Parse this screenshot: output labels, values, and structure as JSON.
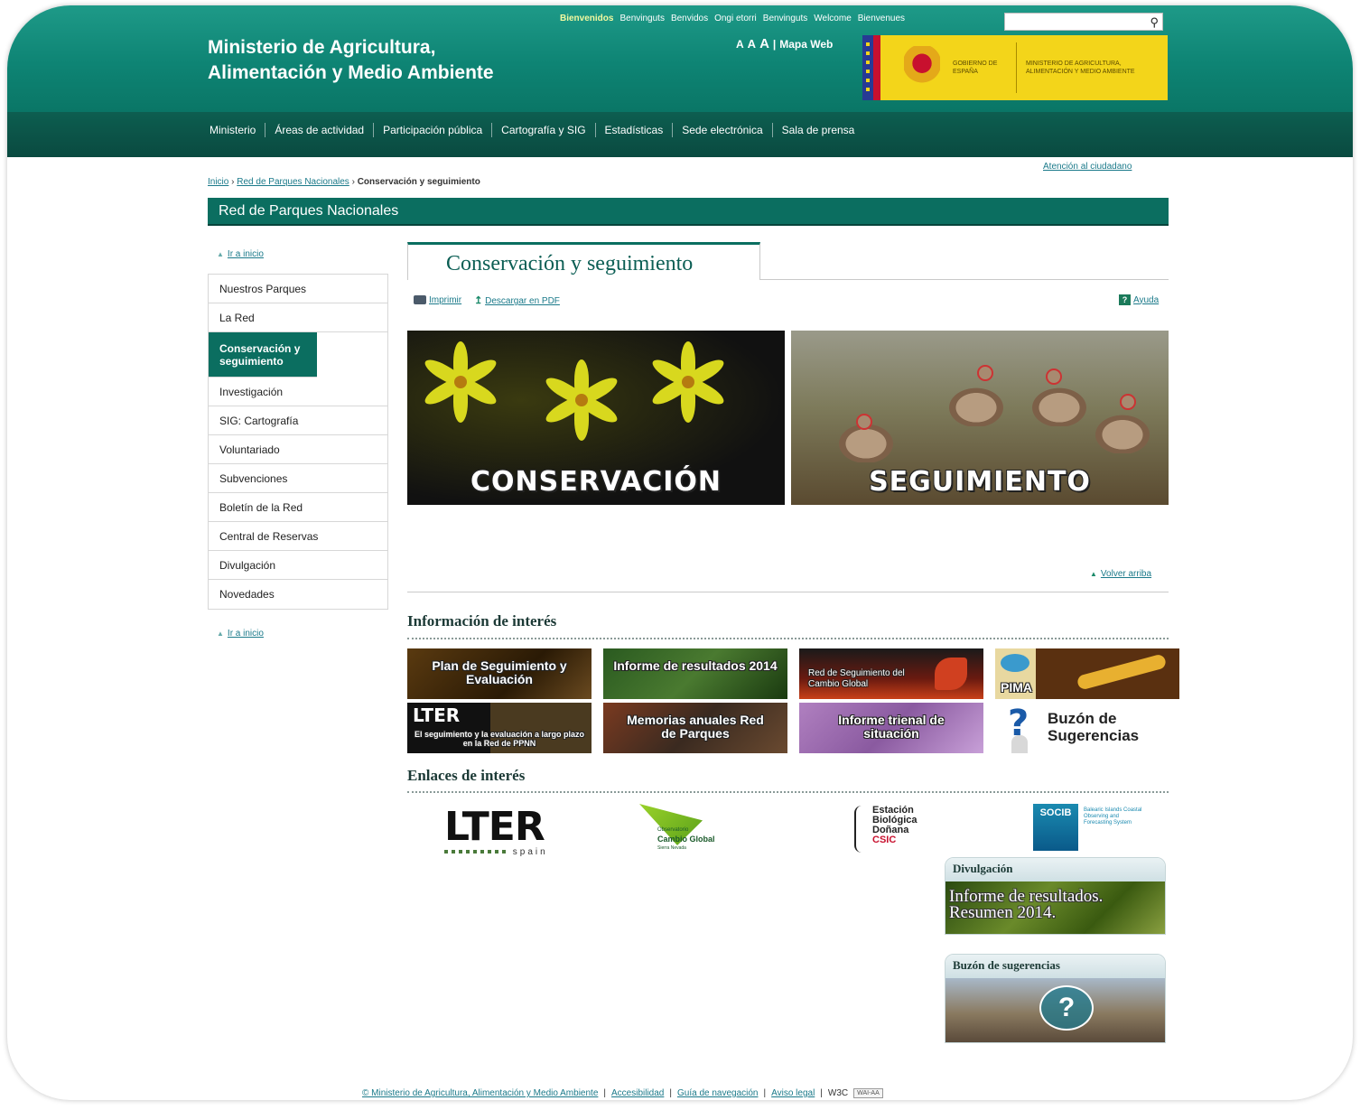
{
  "header": {
    "title_line1": "Ministerio de Agricultura,",
    "title_line2": "Alimentación y Medio Ambiente",
    "languages": [
      "Bienvenidos",
      "Benvinguts",
      "Benvidos",
      "Ongi etorri",
      "Benvinguts",
      "Welcome",
      "Bienvenues"
    ],
    "font_size_labels": [
      "A",
      "A",
      "A"
    ],
    "map_link": "Mapa Web",
    "gov_label": "GOBIERNO DE ESPAÑA",
    "ministry_label": "MINISTERIO DE AGRICULTURA, ALIMENTACIÓN Y MEDIO AMBIENTE",
    "search_icon": "search-icon"
  },
  "nav": [
    "Ministerio",
    "Áreas de actividad",
    "Participación pública",
    "Cartografía y SIG",
    "Estadísticas",
    "Sede electrónica",
    "Sala de prensa"
  ],
  "breadcrumb": {
    "home": "Inicio",
    "parent": "Red de Parques Nacionales",
    "current": "Conservación y seguimiento",
    "separator": "›"
  },
  "attention_link": "Atención al ciudadano",
  "section_title": "Red de Parques Nacionales",
  "goto_top_label": "Ir a inicio",
  "sidenav": [
    "Nuestros Parques",
    "La Red",
    "Conservación y seguimiento",
    "Investigación",
    "SIG: Cartografía",
    "Voluntariado",
    "Subvenciones",
    "Boletín de la Red",
    "Central de Reservas",
    "Divulgación",
    "Novedades"
  ],
  "main": {
    "tab_title": "Conservación y seguimiento",
    "print_label": "Imprimir",
    "pdf_label": "Descargar en PDF",
    "help_label": "Ayuda",
    "banner_left": "CONSERVACIÓN",
    "banner_right": "SEGUIMIENTO",
    "back_top": "Volver arriba"
  },
  "info_section": {
    "title": "Información de interés",
    "tiles": [
      "Plan de Seguimiento y Evaluación",
      "Informe de resultados 2014",
      "Red de Seguimiento del Cambio Global",
      "PIMA",
      "El seguimiento y la evaluación a largo plazo en la Red de PPNN",
      "Memorias anuales Red de Parques",
      "Informe trienal de situación",
      "Buzón de Sugerencias"
    ],
    "lter_label": "LTER"
  },
  "links_section": {
    "title": "Enlaces de interés",
    "lter": "LTER",
    "lter_sub": "spain",
    "ocg_small": "Observatorio",
    "ocg": "Cambio Global",
    "ocg_sub": "Sierra Nevada",
    "ebd": [
      "Estación",
      "Biológica",
      "Doñana",
      "CSIC"
    ],
    "socib": "SOCIB",
    "socib_text": "Balearic Islands Coastal Observing and Forecasting System"
  },
  "side_boxes": {
    "divulgacion_title": "Divulgación",
    "divulgacion_text_line1": "Informe de resultados.",
    "divulgacion_text_line2": "Resumen 2014.",
    "buzon_title": "Buzón de sugerencias",
    "buzon_symbol": "?"
  },
  "footer": {
    "copyright": "© Ministerio de Agricultura, Alimentación y Medio Ambiente",
    "accessibility": "Accesibilidad",
    "nav_guide": "Guía de navegación",
    "legal": "Aviso legal",
    "w3c": "W3C",
    "wai": "WAI-AA"
  },
  "colors": {
    "brand_green": "#0b6e60",
    "header_green": "#1e9a88",
    "link": "#1b7a8a"
  }
}
